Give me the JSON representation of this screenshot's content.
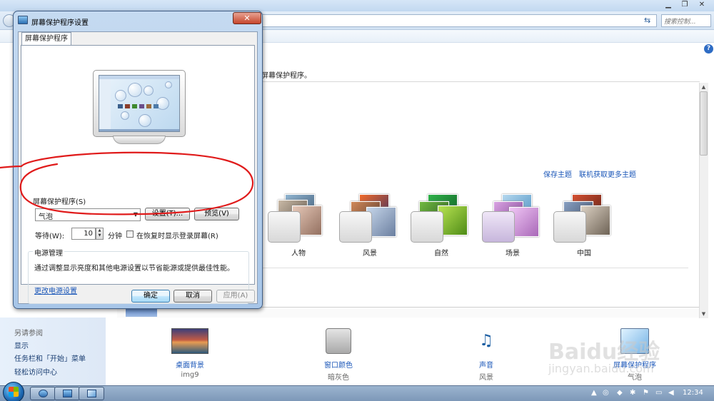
{
  "window": {
    "search_placeholder": "搜索控制...",
    "description_fragment": "屏幕保护程序。",
    "links": [
      "保存主题",
      "联机获取更多主题"
    ],
    "themes": [
      {
        "label": "人物"
      },
      {
        "label": "风景"
      },
      {
        "label": "自然"
      },
      {
        "label": "场景"
      },
      {
        "label": "中国"
      }
    ],
    "sidebar": {
      "heading": "另请参阅",
      "items": [
        "显示",
        "任务栏和「开始」菜单",
        "轻松访问中心"
      ]
    },
    "bottom": [
      {
        "title": "桌面背景",
        "value": "img9",
        "icon": "desktop-background-icon"
      },
      {
        "title": "窗口颜色",
        "value": "暗灰色",
        "icon": "window-color-icon"
      },
      {
        "title": "声音",
        "value": "风景",
        "icon": "sound-icon"
      },
      {
        "title": "屏幕保护程序",
        "value": "气泡",
        "icon": "screensaver-icon"
      }
    ]
  },
  "dialog": {
    "title": "屏幕保护程序设置",
    "close_glyph": "✕",
    "tab": "屏幕保护程序",
    "screensaver_label": "屏幕保护程序(S)",
    "screensaver_value": "气泡",
    "settings_button": "设置(T)...",
    "preview_button": "预览(V)",
    "wait_label": "等待(W):",
    "wait_value": "10",
    "wait_unit": "分钟",
    "resume_checkbox_label": "在恢复时显示登录屏幕(R)",
    "resume_checked": false,
    "power_group_label": "电源管理",
    "power_text": "通过调整显示亮度和其他电源设置以节省能源或提供最佳性能。",
    "power_link": "更改电源设置",
    "ok_button": "确定",
    "cancel_button": "取消",
    "apply_button": "应用(A)"
  },
  "taskbar": {
    "time": "12:34"
  },
  "watermark": {
    "line1": "Baidu经验",
    "line2": "jingyan.baidu.com"
  },
  "colors": {
    "accent_link": "#1a56b8",
    "annotation": "#e01b1b",
    "close_button": "#c6452b"
  }
}
